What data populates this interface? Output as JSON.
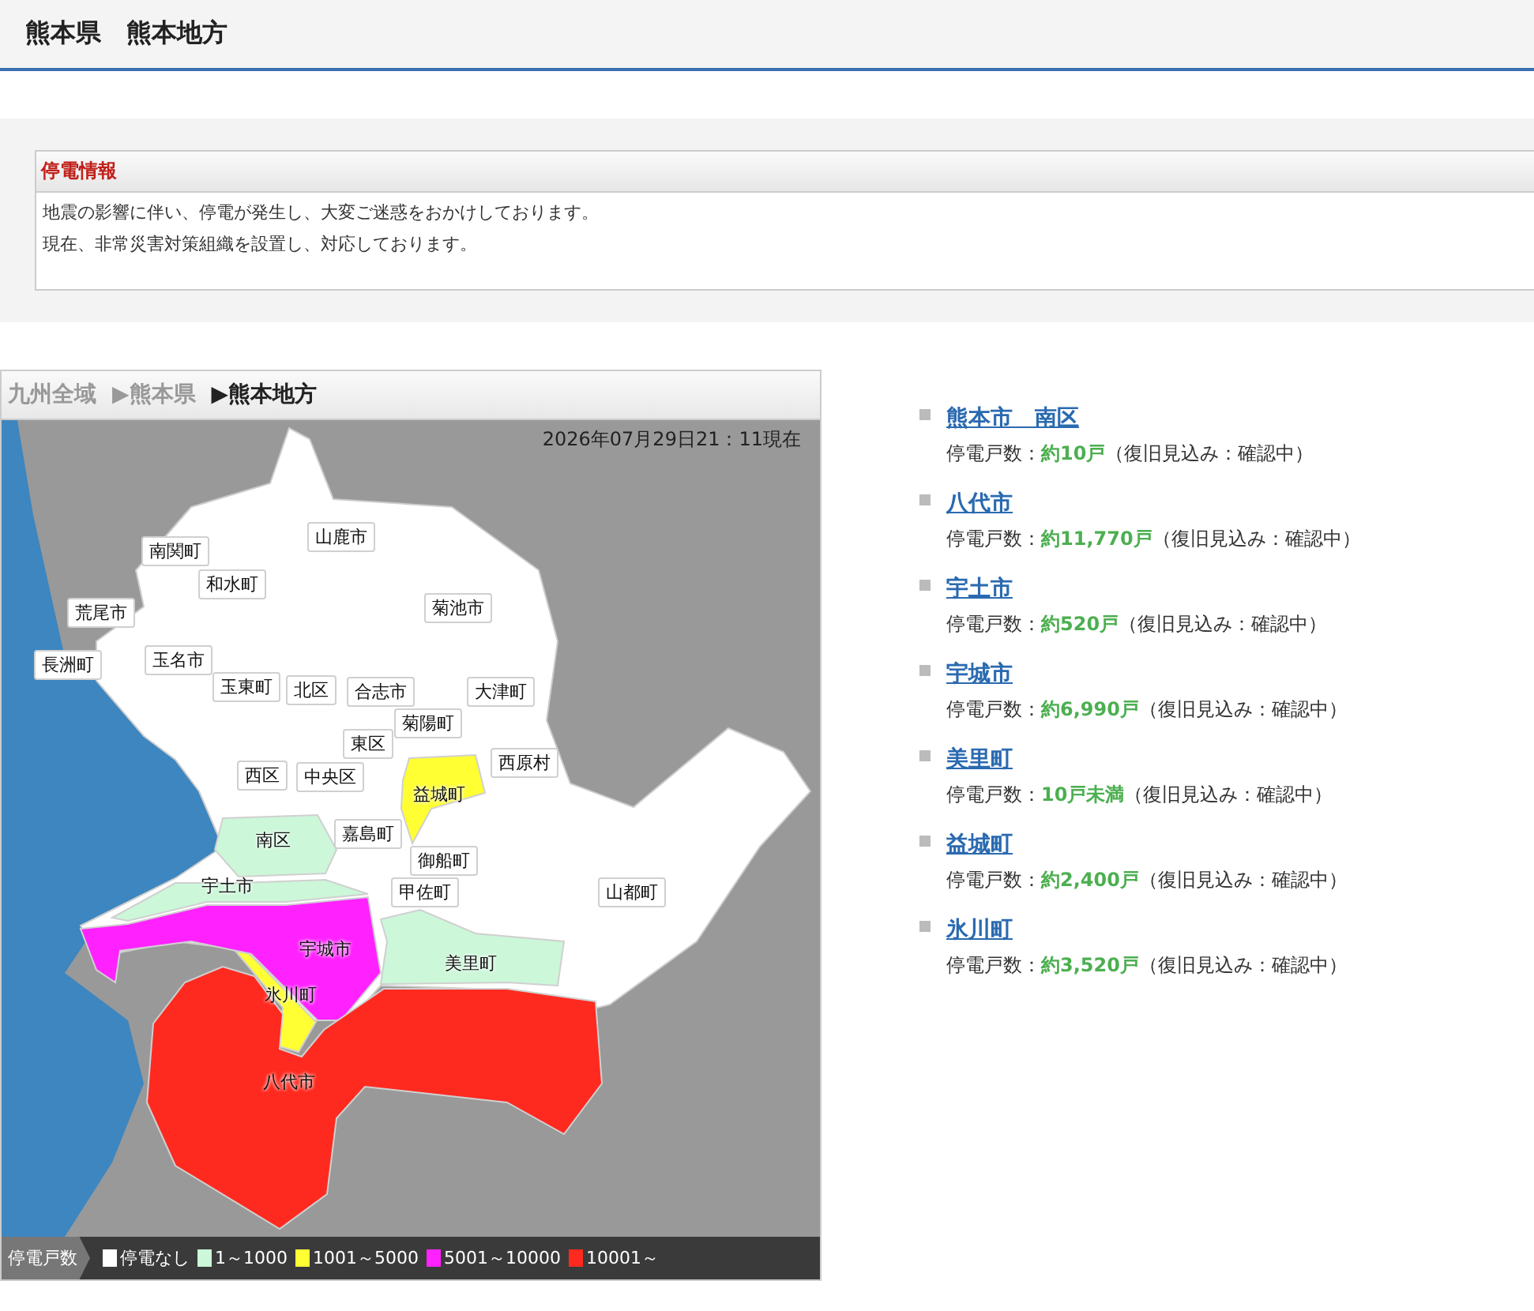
{
  "header": {
    "title": "熊本県　熊本地方"
  },
  "notice": {
    "title": "停電情報",
    "lines": [
      "地震の影響に伴い、停電が発生し、大変ご迷惑をおかけしております。",
      "現在、非常災害対策組織を設置し、対応しております。"
    ]
  },
  "breadcrumb": [
    {
      "label": "九州全域",
      "selected": false
    },
    {
      "arrow": "▶",
      "label": "熊本県",
      "selected": false
    },
    {
      "arrow": "▶",
      "label": "熊本地方",
      "selected": true
    }
  ],
  "timestamp": "2026年07月29日21：11現在",
  "regions": [
    {
      "name": "荒尾市",
      "color": "#ffffff"
    },
    {
      "name": "長洲町",
      "color": "#ffffff"
    },
    {
      "name": "南関町",
      "color": "#ffffff"
    },
    {
      "name": "和水町",
      "color": "#ffffff"
    },
    {
      "name": "山鹿市",
      "color": "#ffffff"
    },
    {
      "name": "菊池市",
      "color": "#ffffff"
    },
    {
      "name": "玉名市",
      "color": "#ffffff"
    },
    {
      "name": "玉東町",
      "color": "#ffffff"
    },
    {
      "name": "北区",
      "color": "#ffffff"
    },
    {
      "name": "合志市",
      "color": "#ffffff"
    },
    {
      "name": "大津町",
      "color": "#ffffff"
    },
    {
      "name": "菊陽町",
      "color": "#ffffff"
    },
    {
      "name": "東区",
      "color": "#ffffff"
    },
    {
      "name": "西原村",
      "color": "#ffffff"
    },
    {
      "name": "西区",
      "color": "#ffffff"
    },
    {
      "name": "中央区",
      "color": "#ffffff"
    },
    {
      "name": "益城町",
      "color": "#ffff33"
    },
    {
      "name": "南区",
      "color": "#ccf7d9"
    },
    {
      "name": "嘉島町",
      "color": "#ffffff"
    },
    {
      "name": "御船町",
      "color": "#ffffff"
    },
    {
      "name": "宇土市",
      "color": "#ccf7d9"
    },
    {
      "name": "甲佐町",
      "color": "#ffffff"
    },
    {
      "name": "山都町",
      "color": "#ffffff"
    },
    {
      "name": "宇城市",
      "color": "#ff22ff"
    },
    {
      "name": "美里町",
      "color": "#ccf7d9"
    },
    {
      "name": "氷川町",
      "color": "#ffff33"
    },
    {
      "name": "八代市",
      "color": "#ff2a1f"
    }
  ],
  "legend": {
    "title": "停電戸数",
    "items": [
      {
        "label": "停電なし",
        "color": "#ffffff"
      },
      {
        "label": "1～1000",
        "color": "#ccf7d9"
      },
      {
        "label": "1001～5000",
        "color": "#ffff33"
      },
      {
        "label": "5001～10000",
        "color": "#ff22ff"
      },
      {
        "label": "10001～",
        "color": "#ff2a1f"
      }
    ]
  },
  "outages": [
    {
      "name": "熊本市　南区",
      "label": "停電戸数：",
      "count": "約10戸",
      "note": "（復旧見込み：確認中）"
    },
    {
      "name": "八代市",
      "label": "停電戸数：",
      "count": "約11,770戸",
      "note": "（復旧見込み：確認中）"
    },
    {
      "name": "宇土市",
      "label": "停電戸数：",
      "count": "約520戸",
      "note": "（復旧見込み：確認中）"
    },
    {
      "name": "宇城市",
      "label": "停電戸数：",
      "count": "約6,990戸",
      "note": "（復旧見込み：確認中）"
    },
    {
      "name": "美里町",
      "label": "停電戸数：",
      "count": "10戸未満",
      "note": "（復旧見込み：確認中）"
    },
    {
      "name": "益城町",
      "label": "停電戸数：",
      "count": "約2,400戸",
      "note": "（復旧見込み：確認中）"
    },
    {
      "name": "氷川町",
      "label": "停電戸数：",
      "count": "約3,520戸",
      "note": "（復旧見込み：確認中）"
    }
  ]
}
